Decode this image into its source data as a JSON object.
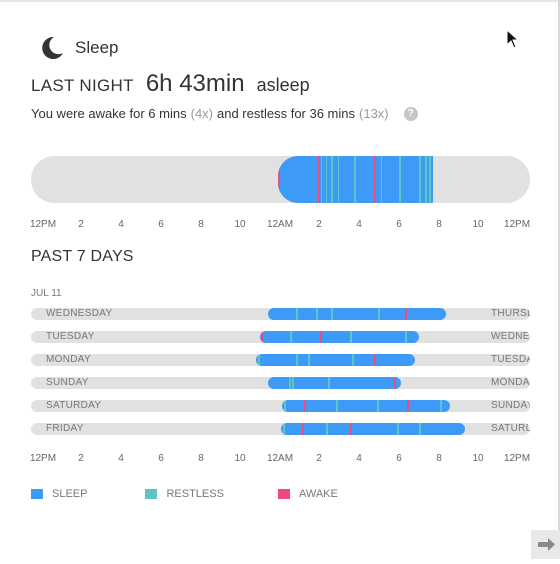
{
  "header": {
    "title": "Sleep",
    "moon_icon": "moon-icon"
  },
  "last_night": {
    "label": "LAST NIGHT",
    "duration": "6h 43min",
    "suffix": "asleep",
    "awake_text_1": "You were awake for 6 mins",
    "awake_count": "(4x)",
    "awake_text_2": "and restless for 36 mins",
    "restless_count": "(13x)",
    "help_label": "?"
  },
  "axis_labels": [
    "12PM",
    "2",
    "4",
    "6",
    "8",
    "10",
    "12AM",
    "2",
    "4",
    "6",
    "8",
    "10",
    "12PM"
  ],
  "past": {
    "title": "PAST 7 DAYS",
    "date": "JUL 11",
    "days": [
      {
        "label": "WEDNESDAY",
        "next": "THURSDAY"
      },
      {
        "label": "TUESDAY",
        "next": "WEDNESDAY"
      },
      {
        "label": "MONDAY",
        "next": "TUESDAY"
      },
      {
        "label": "SUNDAY",
        "next": "MONDAY"
      },
      {
        "label": "SATURDAY",
        "next": "SUNDAY"
      },
      {
        "label": "FRIDAY",
        "next": "SATURDAY"
      }
    ]
  },
  "legend": [
    {
      "label": "SLEEP",
      "color": "#3d9bf7"
    },
    {
      "label": "RESTLESS",
      "color": "#5ec4c4"
    },
    {
      "label": "AWAKE",
      "color": "#ee4a7c"
    }
  ],
  "colors": {
    "sleep": "#3d9bf7",
    "restless": "#5ec4c4",
    "awake": "#ee4a7c",
    "track": "#e1e1e1"
  },
  "chart_data": {
    "type": "bar",
    "x_axis": [
      "12PM",
      "2",
      "4",
      "6",
      "8",
      "10",
      "12AM",
      "2",
      "4",
      "6",
      "8",
      "10",
      "12PM"
    ],
    "last_night": {
      "sleep_start_hour": 12.3,
      "sleep_end_hour": 19.8
    },
    "series": [
      {
        "name": "WEDNESDAY",
        "start_hour": 11.9,
        "end_hour": 20.5
      },
      {
        "name": "TUESDAY",
        "start_hour": 11.5,
        "end_hour": 19.7
      },
      {
        "name": "MONDAY",
        "start_hour": 11.3,
        "end_hour": 19.5
      },
      {
        "name": "SUNDAY",
        "start_hour": 11.9,
        "end_hour": 18.9
      },
      {
        "name": "SATURDAY",
        "start_hour": 12.6,
        "end_hour": 20.7
      },
      {
        "name": "FRIDAY",
        "start_hour": 12.5,
        "end_hour": 21.7
      }
    ]
  }
}
